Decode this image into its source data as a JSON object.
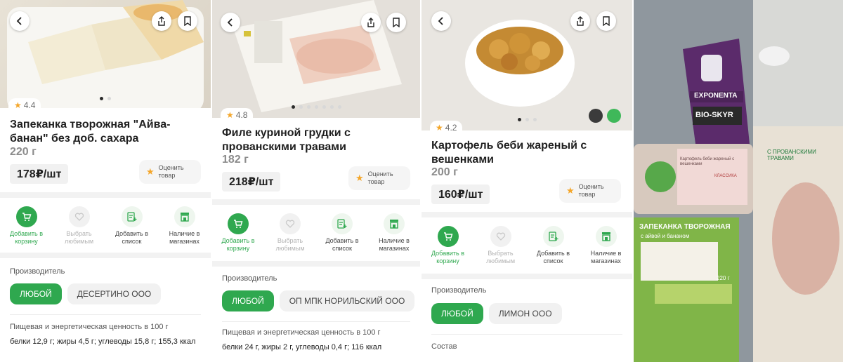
{
  "panels": [
    {
      "rating": "4.4",
      "title": "Запеканка творожная \"Айва-банан\" без доб. сахара",
      "weight": "220 г",
      "price": "178₽/шт",
      "rate_label": "Оценить товар",
      "actions": [
        "Добавить в корзину",
        "Выбрать любимым",
        "Добавить в список",
        "Наличие в магазинах"
      ],
      "producer_label": "Производитель",
      "chips": [
        "ЛЮБОЙ",
        "ДЕСЕРТИНО ООО"
      ],
      "nutrition_title": "Пищевая и энергетическая ценность в 100 г",
      "nutrition": "белки 12,9 г; жиры 4,5 г; углеводы 15,8 г; 155,3 ккал"
    },
    {
      "rating": "4.8",
      "title": "Филе куриной грудки с прованскими травами",
      "weight": "182 г",
      "price": "218₽/шт",
      "rate_label": "Оценить товар",
      "actions": [
        "Добавить в корзину",
        "Выбрать любимым",
        "Добавить в список",
        "Наличие в магазинах"
      ],
      "producer_label": "Производитель",
      "chips": [
        "ЛЮБОЙ",
        "ОП МПК НОРИЛЬСКИЙ ООО"
      ],
      "nutrition_title": "Пищевая и энергетическая ценность в 100 г",
      "nutrition": "белки 24 г, жиры 2 г, углеводы 0,4 г; 116 ккал"
    },
    {
      "rating": "4.2",
      "title": "Картофель беби жареный с вешенками",
      "weight": "200 г",
      "price": "160₽/шт",
      "rate_label": "Оценить товар",
      "actions": [
        "Добавить в корзину",
        "Выбрать любимым",
        "Добавить в список",
        "Наличие в магазинах"
      ],
      "producer_label": "Производитель",
      "chips": [
        "ЛЮБОЙ",
        "ЛИМОН ООО"
      ],
      "composition_label": "Состав"
    }
  ],
  "photo": {
    "brand": "EXPONENTA",
    "product": "BIO-SKYR",
    "tray_label": "ЗАПЕКАНКА ТВОРОЖНАЯ",
    "tray_sub": "с айвой и бананом",
    "tray_weight": "220 г",
    "pack_label": "С ПРОВАНСКИМИ ТРАВАМИ",
    "potato_label": "Картофель беби жареный с вешенками",
    "potato_tag": "КЛАССИКА"
  },
  "icons": [
    "back-icon",
    "share-icon",
    "bookmark-icon",
    "cart-icon",
    "heart-icon",
    "list-add-icon",
    "store-icon",
    "star-icon"
  ],
  "colors": {
    "accent": "#2fa84f",
    "star": "#f4a62a"
  }
}
